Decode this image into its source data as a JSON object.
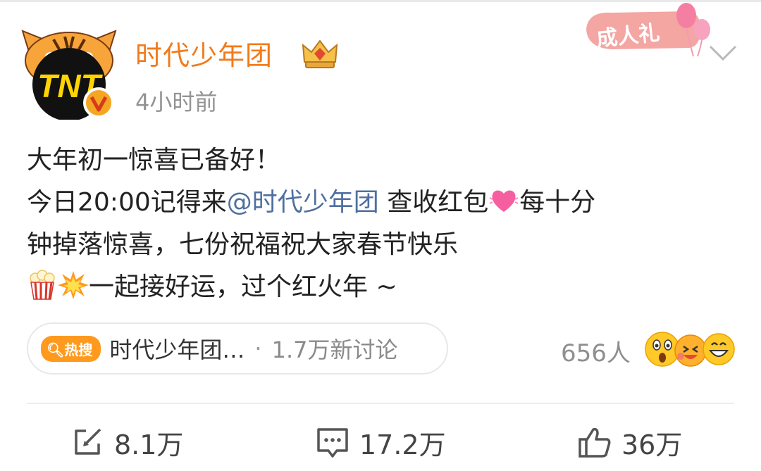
{
  "post": {
    "author": "时代少年团",
    "time": "4小时前",
    "badge": "成人礼",
    "lines": [
      {
        "text": "大年初一惊喜已备好！"
      },
      {
        "before": "今日20:00记得来",
        "mention": "@时代少年团",
        "middle": " 查收红包",
        "after": "每十分"
      },
      {
        "text": "钟掉落惊喜，七份祝福祝大家春节快乐"
      },
      {
        "after": "一起接好运，过个红火年 ~"
      }
    ]
  },
  "hot_search": {
    "tag": "热搜",
    "title": "时代少年团…",
    "separator": "·",
    "count": "1.7万新讨论"
  },
  "reactions": {
    "count": "656人"
  },
  "actions": {
    "repost": "8.1万",
    "comment": "17.2万",
    "like": "36万"
  },
  "colors": {
    "author": "#f27a1a",
    "mention": "#4f6fa0",
    "hot_tag": "#ff9a1e"
  }
}
